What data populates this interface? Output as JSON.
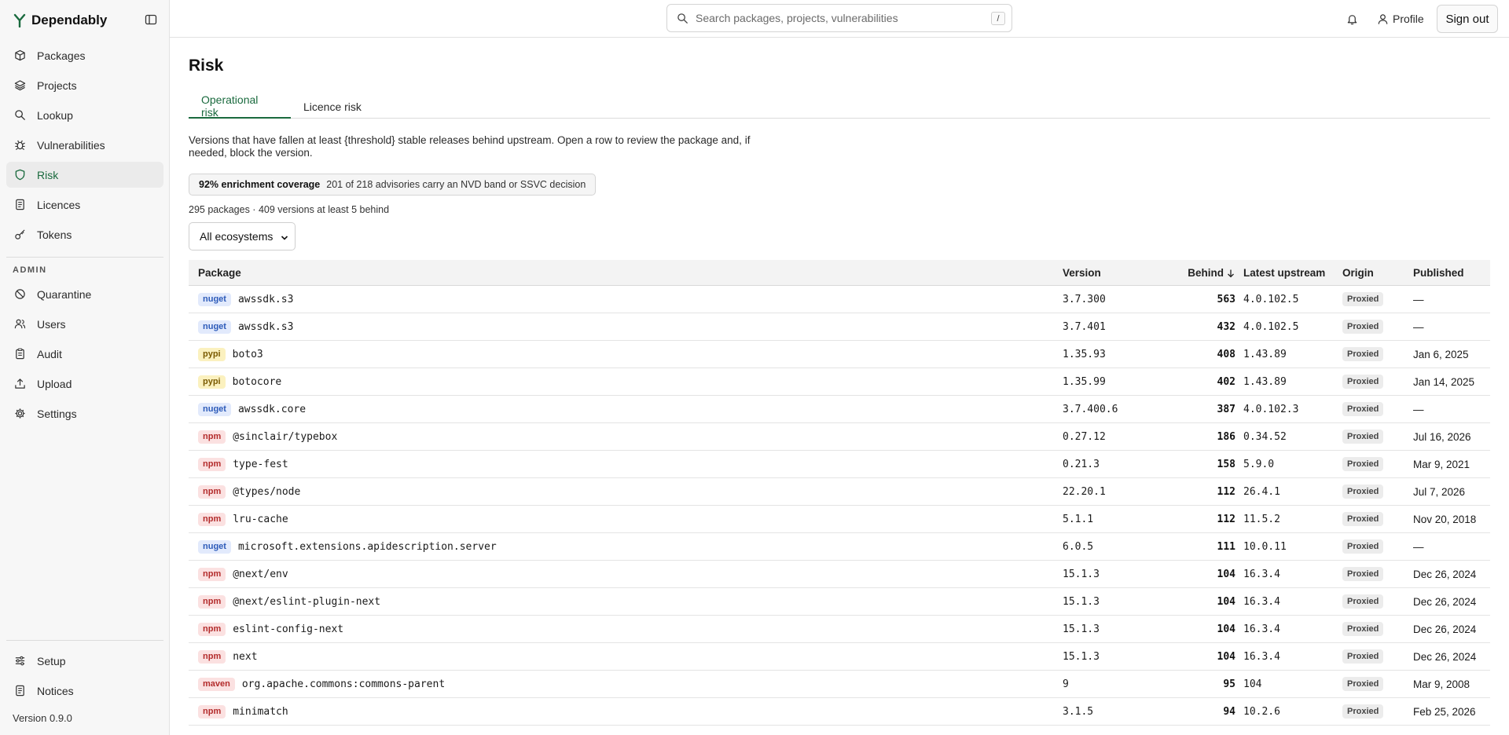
{
  "app": {
    "name": "Dependably",
    "version": "Version 0.9.0"
  },
  "sidebar": {
    "items": [
      {
        "label": "Packages",
        "icon": "package-icon"
      },
      {
        "label": "Projects",
        "icon": "layers-icon"
      },
      {
        "label": "Lookup",
        "icon": "search-icon"
      },
      {
        "label": "Vulnerabilities",
        "icon": "bug-icon"
      },
      {
        "label": "Risk",
        "icon": "shield-icon",
        "active": true
      },
      {
        "label": "Licences",
        "icon": "document-icon"
      },
      {
        "label": "Tokens",
        "icon": "key-icon"
      }
    ],
    "admin_label": "ADMIN",
    "admin_items": [
      {
        "label": "Quarantine",
        "icon": "ban-icon"
      },
      {
        "label": "Users",
        "icon": "users-icon"
      },
      {
        "label": "Audit",
        "icon": "clipboard-icon"
      },
      {
        "label": "Upload",
        "icon": "upload-icon"
      },
      {
        "label": "Settings",
        "icon": "gear-icon"
      }
    ],
    "footer_items": [
      {
        "label": "Setup",
        "icon": "sliders-icon"
      },
      {
        "label": "Notices",
        "icon": "document-icon"
      }
    ]
  },
  "topbar": {
    "search_placeholder": "Search packages, projects, vulnerabilities",
    "search_shortcut": "/",
    "profile_label": "Profile",
    "signout_label": "Sign out"
  },
  "page": {
    "title": "Risk",
    "tabs": [
      {
        "label": "Operational risk",
        "active": true
      },
      {
        "label": "Licence risk"
      }
    ],
    "description": "Versions that have fallen at least {threshold} stable releases behind upstream. Open a row to review the package and, if needed, block the version.",
    "coverage": {
      "strong": "92% enrichment coverage",
      "text": "201 of 218 advisories carry an NVD band or SSVC decision"
    },
    "counts": "295 packages · 409 versions at least 5 behind",
    "ecosystem_select": "All ecosystems"
  },
  "table": {
    "headers": {
      "package": "Package",
      "version": "Version",
      "behind": "Behind",
      "latest": "Latest upstream",
      "origin": "Origin",
      "published": "Published"
    },
    "rows": [
      {
        "eco": "nuget",
        "name": "awssdk.s3",
        "version": "3.7.300",
        "behind": "563",
        "latest": "4.0.102.5",
        "origin": "Proxied",
        "published": "—"
      },
      {
        "eco": "nuget",
        "name": "awssdk.s3",
        "version": "3.7.401",
        "behind": "432",
        "latest": "4.0.102.5",
        "origin": "Proxied",
        "published": "—"
      },
      {
        "eco": "pypi",
        "name": "boto3",
        "version": "1.35.93",
        "behind": "408",
        "latest": "1.43.89",
        "origin": "Proxied",
        "published": "Jan 6, 2025"
      },
      {
        "eco": "pypi",
        "name": "botocore",
        "version": "1.35.99",
        "behind": "402",
        "latest": "1.43.89",
        "origin": "Proxied",
        "published": "Jan 14, 2025"
      },
      {
        "eco": "nuget",
        "name": "awssdk.core",
        "version": "3.7.400.6",
        "behind": "387",
        "latest": "4.0.102.3",
        "origin": "Proxied",
        "published": "—"
      },
      {
        "eco": "npm",
        "name": "@sinclair/typebox",
        "version": "0.27.12",
        "behind": "186",
        "latest": "0.34.52",
        "origin": "Proxied",
        "published": "Jul 16, 2026"
      },
      {
        "eco": "npm",
        "name": "type-fest",
        "version": "0.21.3",
        "behind": "158",
        "latest": "5.9.0",
        "origin": "Proxied",
        "published": "Mar 9, 2021"
      },
      {
        "eco": "npm",
        "name": "@types/node",
        "version": "22.20.1",
        "behind": "112",
        "latest": "26.4.1",
        "origin": "Proxied",
        "published": "Jul 7, 2026"
      },
      {
        "eco": "npm",
        "name": "lru-cache",
        "version": "5.1.1",
        "behind": "112",
        "latest": "11.5.2",
        "origin": "Proxied",
        "published": "Nov 20, 2018"
      },
      {
        "eco": "nuget",
        "name": "microsoft.extensions.apidescription.server",
        "version": "6.0.5",
        "behind": "111",
        "latest": "10.0.11",
        "origin": "Proxied",
        "published": "—"
      },
      {
        "eco": "npm",
        "name": "@next/env",
        "version": "15.1.3",
        "behind": "104",
        "latest": "16.3.4",
        "origin": "Proxied",
        "published": "Dec 26, 2024"
      },
      {
        "eco": "npm",
        "name": "@next/eslint-plugin-next",
        "version": "15.1.3",
        "behind": "104",
        "latest": "16.3.4",
        "origin": "Proxied",
        "published": "Dec 26, 2024"
      },
      {
        "eco": "npm",
        "name": "eslint-config-next",
        "version": "15.1.3",
        "behind": "104",
        "latest": "16.3.4",
        "origin": "Proxied",
        "published": "Dec 26, 2024"
      },
      {
        "eco": "npm",
        "name": "next",
        "version": "15.1.3",
        "behind": "104",
        "latest": "16.3.4",
        "origin": "Proxied",
        "published": "Dec 26, 2024"
      },
      {
        "eco": "maven",
        "name": "org.apache.commons:commons-parent",
        "version": "9",
        "behind": "95",
        "latest": "104",
        "origin": "Proxied",
        "published": "Mar 9, 2008"
      },
      {
        "eco": "npm",
        "name": "minimatch",
        "version": "3.1.5",
        "behind": "94",
        "latest": "10.2.6",
        "origin": "Proxied",
        "published": "Feb 25, 2026"
      }
    ]
  },
  "colors": {
    "accent": "#1a6a3e",
    "nuget": "#2d5bb9",
    "pypi": "#7a5a00",
    "npm": "#b32b2b"
  }
}
